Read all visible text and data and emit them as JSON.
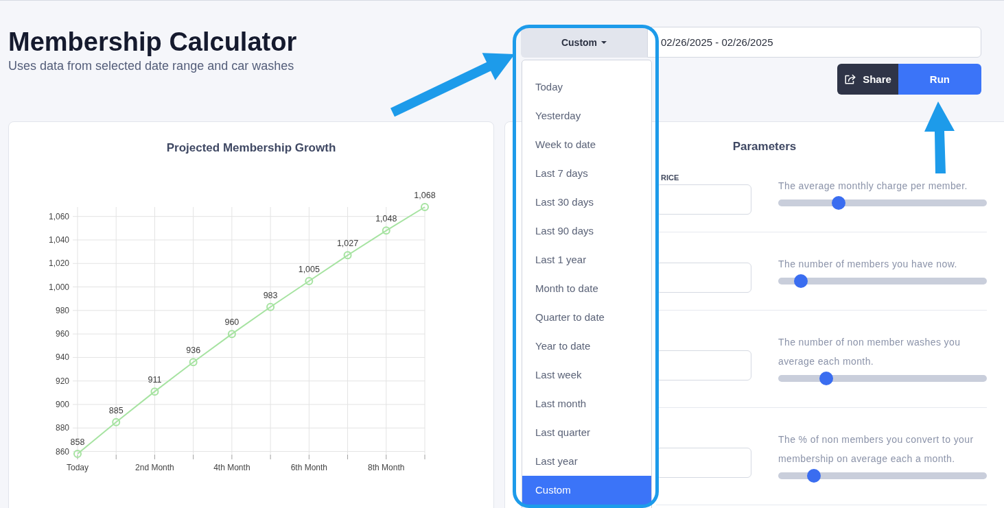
{
  "header": {
    "title": "Membership Calculator",
    "subtitle": "Uses data from selected date range and car washes"
  },
  "date_range": {
    "preset": "Custom",
    "expanded": true,
    "value": "02/26/2025 - 02/26/2025",
    "menu": [
      {
        "label": "Today",
        "selected": false
      },
      {
        "label": "Yesterday",
        "selected": false
      },
      {
        "label": "Week to date",
        "selected": false
      },
      {
        "label": "Last 7 days",
        "selected": false
      },
      {
        "label": "Last 30 days",
        "selected": false
      },
      {
        "label": "Last 90 days",
        "selected": false
      },
      {
        "label": "Last 1 year",
        "selected": false
      },
      {
        "label": "Month to date",
        "selected": false
      },
      {
        "label": "Quarter to date",
        "selected": false
      },
      {
        "label": "Year to date",
        "selected": false
      },
      {
        "label": "Last week",
        "selected": false
      },
      {
        "label": "Last month",
        "selected": false
      },
      {
        "label": "Last quarter",
        "selected": false
      },
      {
        "label": "Last year",
        "selected": false
      },
      {
        "label": "Custom",
        "selected": true
      }
    ]
  },
  "actions": [
    {
      "kind": "share",
      "label": "Share"
    },
    {
      "kind": "run",
      "label": "Run"
    }
  ],
  "growth_chart": {
    "title": "Projected Membership Growth",
    "chart_data": {
      "type": "line",
      "grid": true,
      "x": [
        0,
        1,
        2,
        3,
        4,
        5,
        6,
        7,
        8,
        9
      ],
      "xlim": [
        0,
        9
      ],
      "xticks": [
        {
          "value": 0,
          "label": "Today"
        },
        {
          "value": 2,
          "label": "2nd Month"
        },
        {
          "value": 4,
          "label": "4th Month"
        },
        {
          "value": 6,
          "label": "6th Month"
        },
        {
          "value": 8,
          "label": "8th Month"
        }
      ],
      "ylim": [
        858,
        1068
      ],
      "yticks": [
        860,
        880,
        900,
        920,
        940,
        960,
        980,
        {
          "value": 1000,
          "label": "1,000"
        },
        {
          "value": 1020,
          "label": "1,020"
        },
        {
          "value": 1040,
          "label": "1,040"
        },
        {
          "value": 1060,
          "label": "1,060"
        }
      ],
      "series": [
        {
          "color": "#a6e3a1",
          "marker": "circle",
          "values": [
            858,
            885,
            911,
            936,
            960,
            983,
            1005,
            1027,
            1048,
            1068
          ]
        }
      ],
      "value_labels": [
        "858",
        "885",
        "911",
        "936",
        "960",
        "983",
        "1,005",
        "1,027",
        "1,048",
        "1,068"
      ]
    }
  },
  "parameters": {
    "title": "Parameters",
    "rows": [
      {
        "label": "RICE",
        "description": "The average monthly charge per member.",
        "level": 0.29
      },
      {
        "description": "The number of members you have now.",
        "level": 0.11
      },
      {
        "description": "The number of non member washes you average each month.",
        "level": 0.23
      },
      {
        "description": "The % of non members you convert to your membership on average each a month.",
        "level": 0.17
      }
    ]
  }
}
